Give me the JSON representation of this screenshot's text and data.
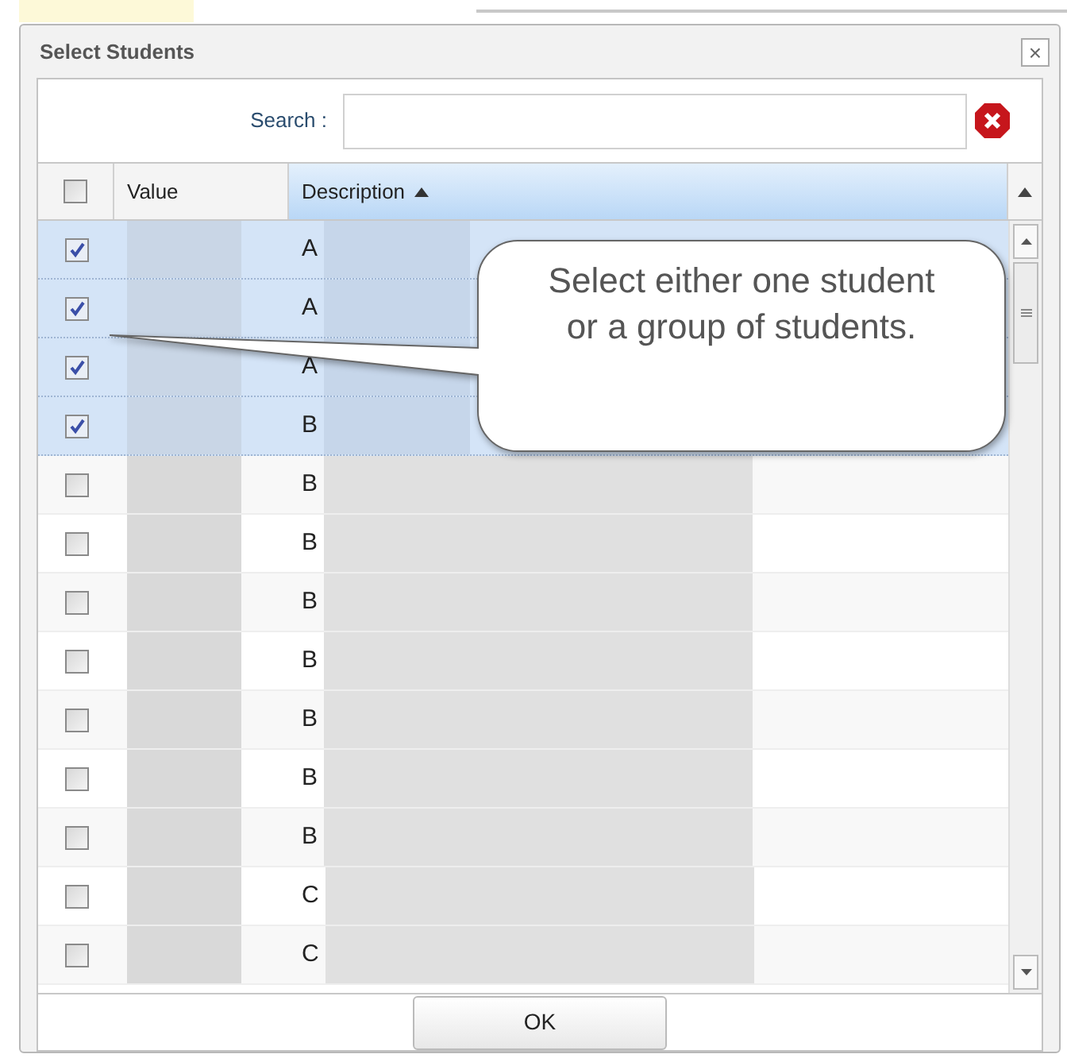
{
  "dialog": {
    "title": "Select Students",
    "close": "×"
  },
  "search": {
    "label": "Search :"
  },
  "table": {
    "columns": [
      {
        "label": "Value",
        "sorted": false
      },
      {
        "label": "Description",
        "sorted": true
      }
    ],
    "all_checked": false,
    "rows": [
      {
        "description": "A",
        "checked": true
      },
      {
        "description": "A",
        "checked": true
      },
      {
        "description": "A",
        "checked": true
      },
      {
        "description": "B",
        "checked": true
      },
      {
        "description": "B",
        "checked": false
      },
      {
        "description": "B",
        "checked": false
      },
      {
        "description": "B",
        "checked": false
      },
      {
        "description": "B",
        "checked": false
      },
      {
        "description": "B",
        "checked": false
      },
      {
        "description": "B",
        "checked": false
      },
      {
        "description": "B",
        "checked": false
      },
      {
        "description": "C",
        "checked": false
      },
      {
        "description": "C",
        "checked": false
      }
    ]
  },
  "callout": {
    "text": "Select either one student or a group of students."
  },
  "buttons": [
    {
      "label": "OK"
    }
  ]
}
